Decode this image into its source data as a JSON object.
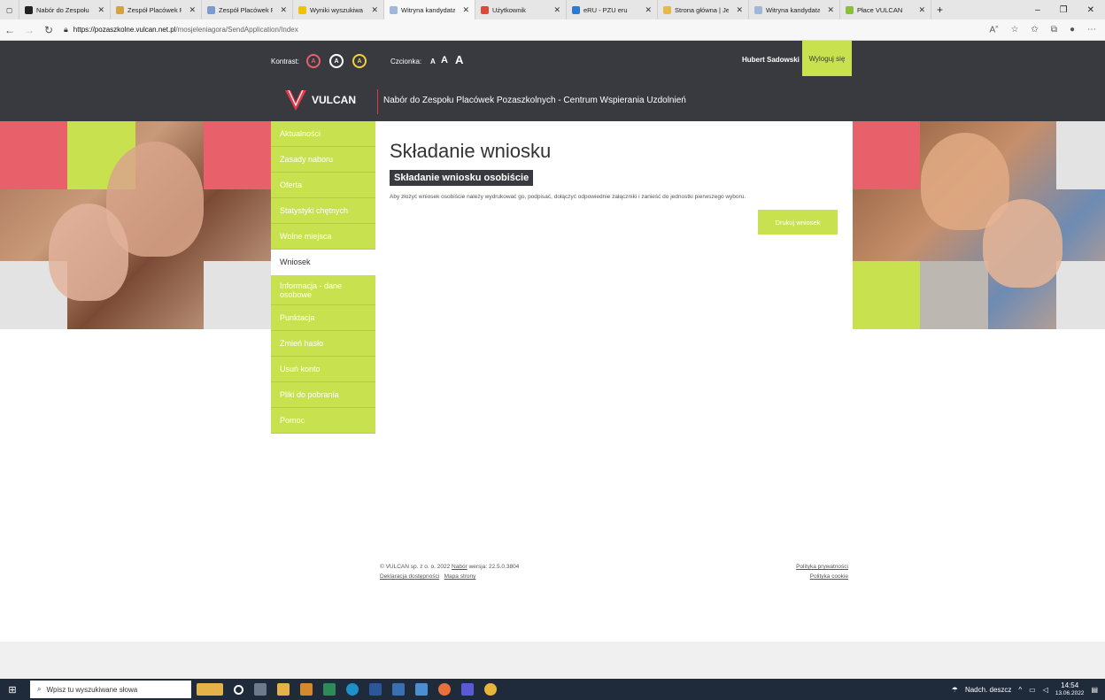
{
  "browser": {
    "tabs": [
      {
        "label": "Nabór do Zespołu",
        "color": "#222222"
      },
      {
        "label": "Zespół Placówek P",
        "color": "#d6a23c"
      },
      {
        "label": "Zespół Placówek P",
        "color": "#7a9ad0"
      },
      {
        "label": "Wyniki wyszukiwa",
        "color": "#f2c200"
      },
      {
        "label": "Witryna kandydata",
        "color": "#9fb7d9",
        "active": true
      },
      {
        "label": "Użytkownik",
        "color": "#e0473a"
      },
      {
        "label": "eRU - PZU eru",
        "color": "#2a7bd1"
      },
      {
        "label": "Strona główna | Je",
        "color": "#e6b94a"
      },
      {
        "label": "Witryna kandydata",
        "color": "#9fb7d9"
      },
      {
        "label": "Płace VULCAN",
        "color": "#8bbf3a"
      }
    ],
    "url_host": "https://pozaszkolne.vulcan.net.pl",
    "url_path": "/mosjeleniagora/SendApplication/Index",
    "new_tab": "+",
    "minimize": "–",
    "restore": "❐",
    "close": "✕"
  },
  "header": {
    "contrast_label": "Kontrast:",
    "contrast_options": [
      "A",
      "A",
      "A"
    ],
    "font_label": "Czcionka:",
    "font_options": [
      "A",
      "A",
      "A"
    ],
    "user_name": "Hubert Sadowski",
    "logout": "Wyloguj się",
    "logo_text": "VULCAN",
    "site_title": "Nabór do Zespołu Placówek Pozaszkolnych - Centrum Wspierania Uzdolnień"
  },
  "menu": {
    "items": [
      {
        "label": "Aktualności"
      },
      {
        "label": "Zasady naboru"
      },
      {
        "label": "Oferta"
      },
      {
        "label": "Statystyki chętnych"
      },
      {
        "label": "Wolne miejsca"
      },
      {
        "label": "Wniosek",
        "active": true
      },
      {
        "label": "Informacja - dane osobowe"
      },
      {
        "label": "Punktacja"
      },
      {
        "label": "Zmień hasło"
      },
      {
        "label": "Usuń konto"
      },
      {
        "label": "Pliki do pobrania"
      },
      {
        "label": "Pomoc"
      }
    ]
  },
  "main": {
    "title": "Składanie wniosku",
    "subtitle": "Składanie wniosku osobiście",
    "description": "Aby złożyć wniosek osobiście należy wydrukować go, podpisać, dołączyć odpowiednie załączniki i zanieść do jednostki pierwszego wyboru.",
    "print_button": "Drukuj wniosek"
  },
  "footer": {
    "copyright": "© VULCAN sp. z o. o. 2022",
    "nabor_link": "Nabór",
    "version": "wersja: 22.5.0.3804",
    "accessibility": "Deklaracja dostępności",
    "sitemap": "Mapa strony",
    "privacy": "Polityka prywatności",
    "cookies": "Polityka cookie"
  },
  "taskbar": {
    "search_placeholder": "Wpisz tu wyszukiwane słowa",
    "weather": "Nadch. deszcz",
    "time": "14:54",
    "date": "13.06.2022"
  },
  "colors": {
    "accent": "#c8e24f",
    "dark": "#393a40",
    "pink": "#e8606a"
  }
}
